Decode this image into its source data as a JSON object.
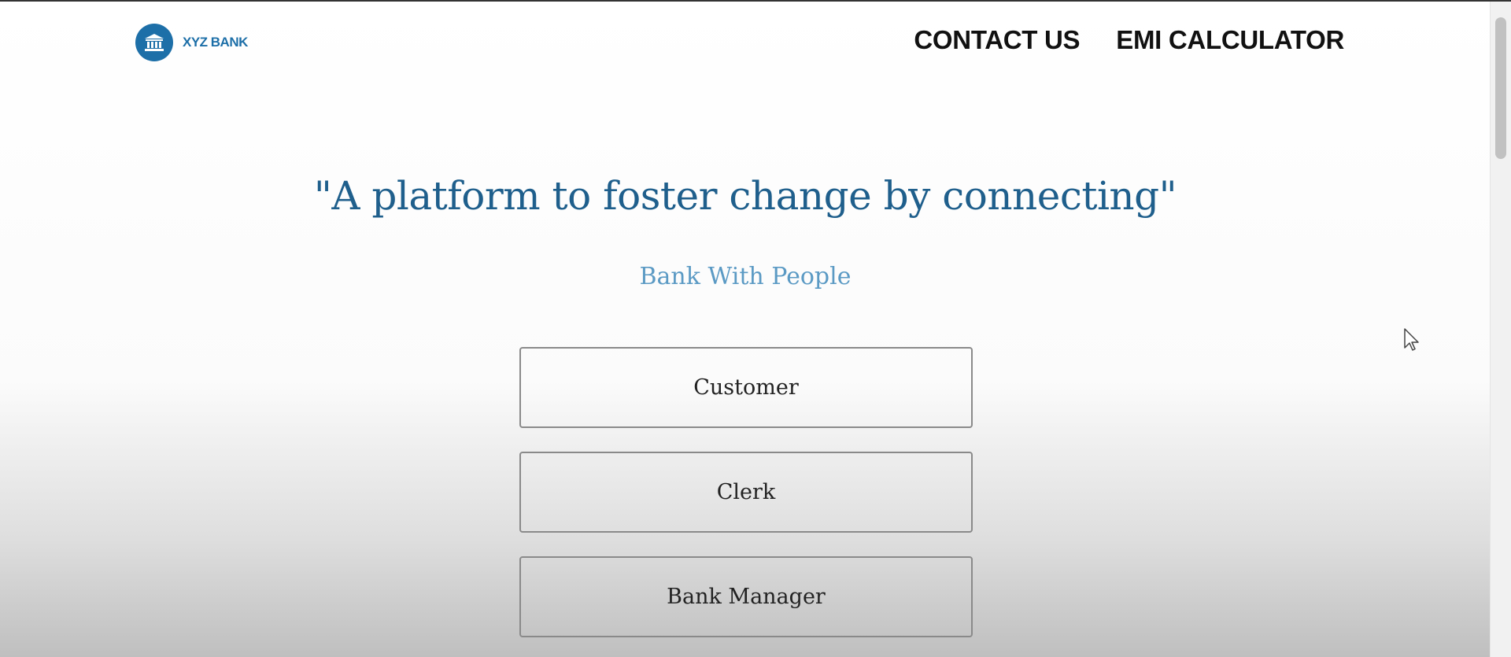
{
  "header": {
    "logo_text": "XYZ BANK",
    "logo_icon": "bank-building-icon",
    "nav": [
      "CONTACT US",
      "EMI CALCULATOR"
    ]
  },
  "hero": {
    "headline": "\"A platform to foster change by connecting\"",
    "subtitle": "Bank With People"
  },
  "roles": [
    "Customer",
    "Clerk",
    "Bank Manager"
  ],
  "colors": {
    "brand": "#1d6fa8",
    "headline": "#1f5f8c",
    "subtitle": "#5b9ac4"
  }
}
